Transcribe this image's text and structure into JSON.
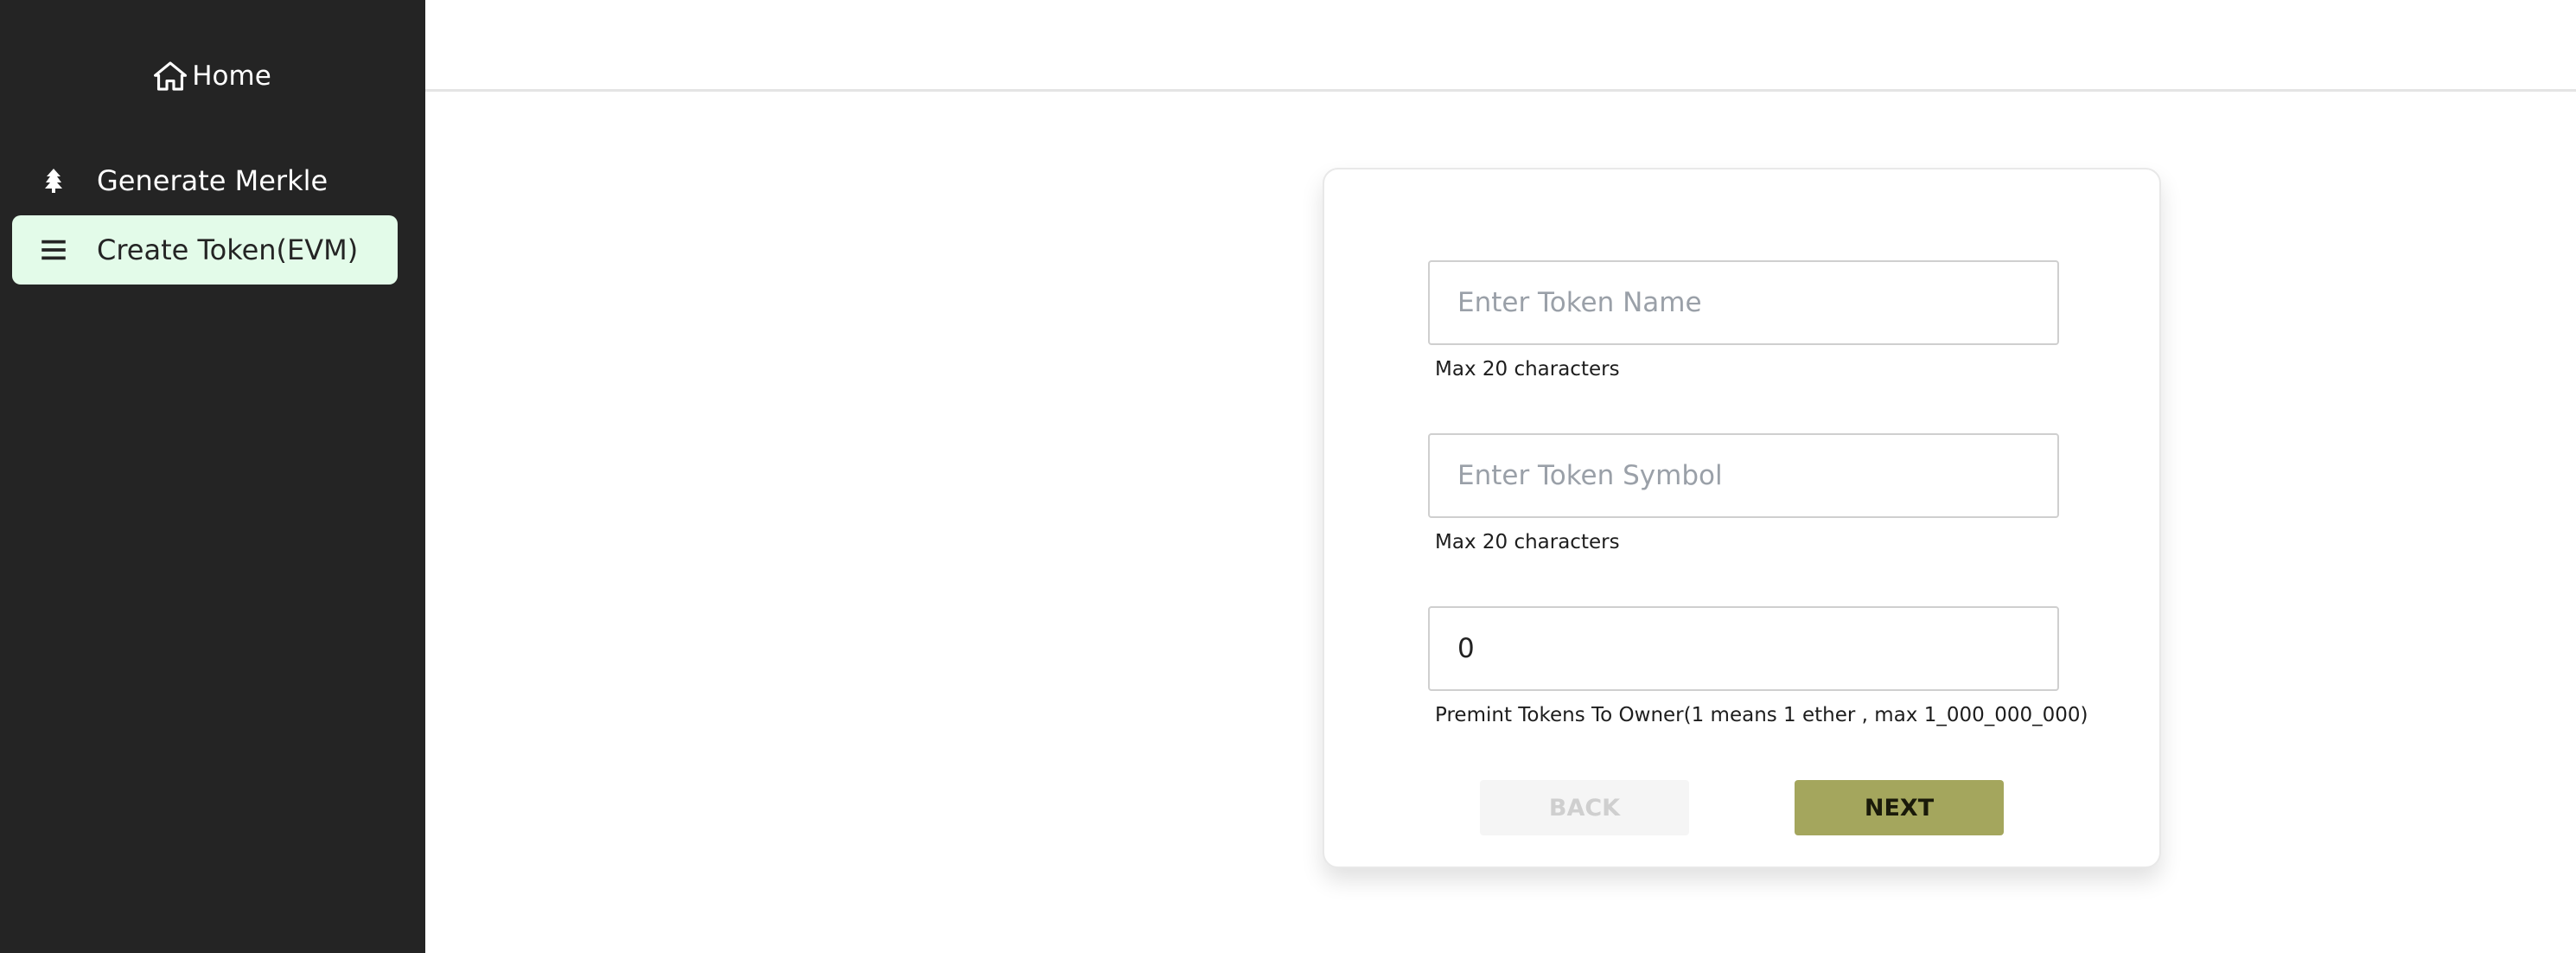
{
  "sidebar": {
    "home_label": "Home",
    "items": [
      {
        "label": "Generate Merkle",
        "icon": "tree-icon",
        "active": false
      },
      {
        "label": "Create Token(EVM)",
        "icon": "menu-icon",
        "active": true
      }
    ]
  },
  "form": {
    "token_name": {
      "value": "",
      "placeholder": "Enter Token Name",
      "hint": "Max 20 characters"
    },
    "token_symbol": {
      "value": "",
      "placeholder": "Enter Token Symbol",
      "hint": "Max 20 characters"
    },
    "premint": {
      "value": "0",
      "hint": "Premint Tokens To Owner(1 means 1 ether , max 1_000_000_000)"
    },
    "back_label": "BACK",
    "next_label": "NEXT"
  },
  "colors": {
    "sidebar_bg": "#242424",
    "active_item_bg": "#e3fbe9",
    "next_button_bg": "#a4a65d"
  }
}
